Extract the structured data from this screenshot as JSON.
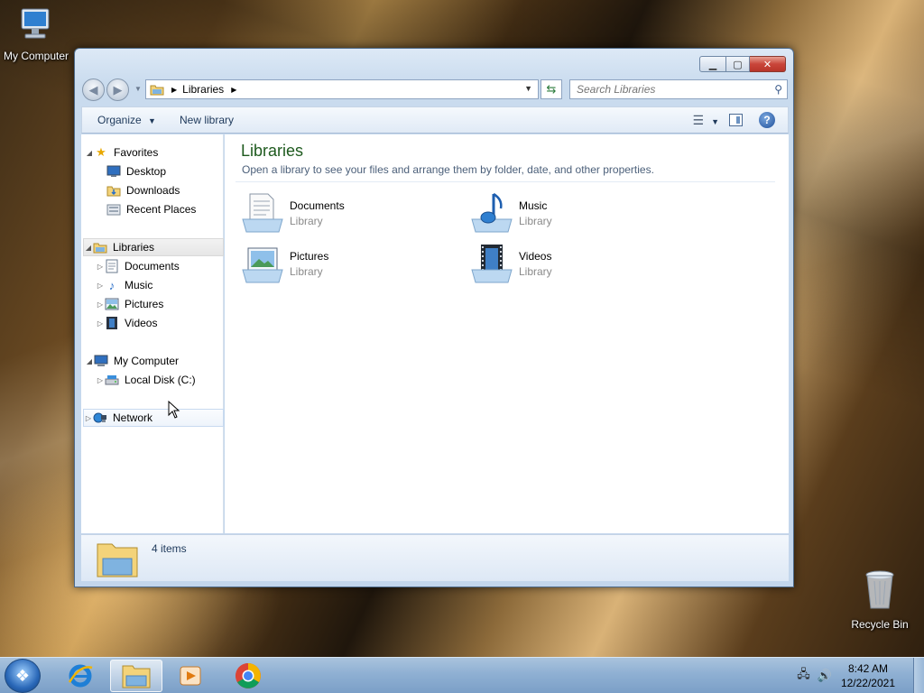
{
  "desktop": {
    "icons": [
      {
        "label": "My Computer"
      },
      {
        "label": "Recycle Bin"
      }
    ]
  },
  "window": {
    "title_buttons": {
      "minimize": "minimize",
      "maximize": "maximize",
      "close": "close"
    },
    "address": {
      "crumb": "Libraries"
    },
    "search": {
      "placeholder": "Search Libraries"
    },
    "toolbar": {
      "organize": "Organize",
      "new_library": "New library"
    },
    "nav": {
      "favorites": "Favorites",
      "favorites_items": [
        "Desktop",
        "Downloads",
        "Recent Places"
      ],
      "libraries": "Libraries",
      "libraries_items": [
        "Documents",
        "Music",
        "Pictures",
        "Videos"
      ],
      "computer": "My Computer",
      "computer_items": [
        "Local Disk (C:)"
      ],
      "network": "Network"
    },
    "content": {
      "title": "Libraries",
      "subtitle": "Open a library to see your files and arrange them by folder, date, and other properties.",
      "items": [
        {
          "name": "Documents",
          "type": "Library",
          "icon": "documents-library-icon"
        },
        {
          "name": "Music",
          "type": "Library",
          "icon": "music-library-icon"
        },
        {
          "name": "Pictures",
          "type": "Library",
          "icon": "pictures-library-icon"
        },
        {
          "name": "Videos",
          "type": "Library",
          "icon": "videos-library-icon"
        }
      ]
    },
    "details": {
      "count": "4 items"
    }
  },
  "taskbar": {
    "apps": [
      "internet-explorer",
      "windows-explorer",
      "media-player",
      "chrome"
    ],
    "time": "8:42 AM",
    "date": "12/22/2021"
  },
  "colors": {
    "content_title": "#1e5a1e",
    "toolbar_text": "#1e395b",
    "close_button": "#c9453a"
  }
}
